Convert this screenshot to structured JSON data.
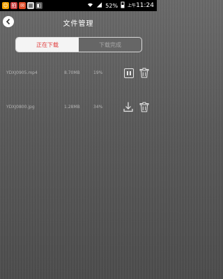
{
  "status_bar": {
    "battery": "52",
    "time_prefix": "上午",
    "time": "11:24"
  },
  "header": {
    "title": "文件管理"
  },
  "tabs": [
    {
      "label": "正在下载",
      "active": true
    },
    {
      "label": "下载完成",
      "active": false
    }
  ],
  "files": [
    {
      "name": "YDXJ0905.mp4",
      "size": "8.70MB",
      "progress": "19%",
      "action": "pause"
    },
    {
      "name": "YDXJ0800.jpg",
      "size": "1.28MB",
      "progress": "34%",
      "action": "download"
    }
  ],
  "colors": {
    "active_tab_text": "#e03a3a",
    "status_bar_bg": "#000000"
  }
}
